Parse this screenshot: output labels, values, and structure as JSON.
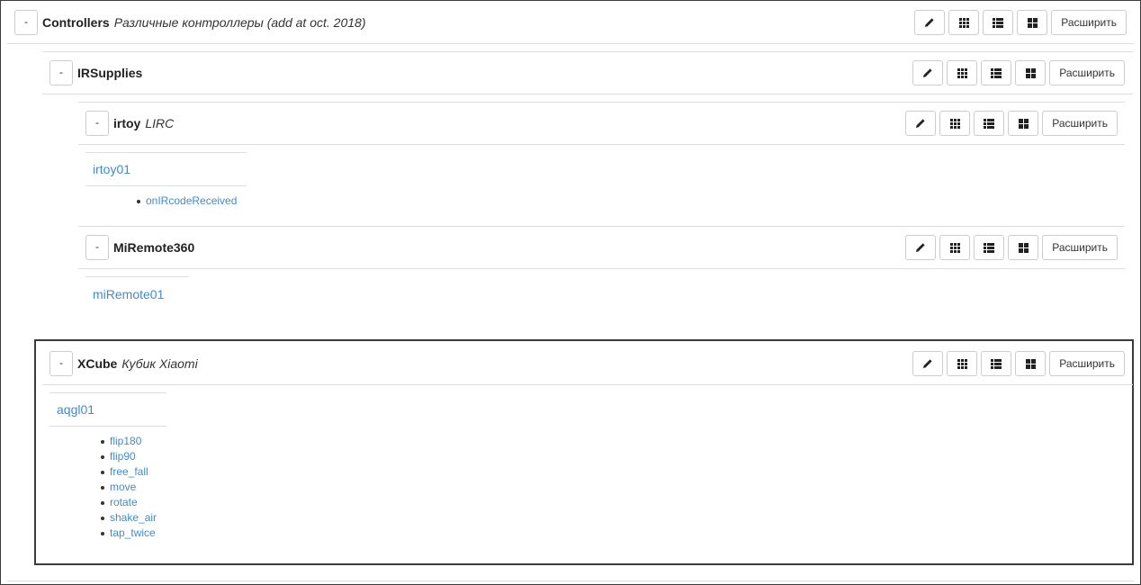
{
  "icons": {
    "edit": "pencil-icon",
    "grid_small": "grid-3x3-icon",
    "list": "list-icon",
    "grid_large": "grid-2x2-icon"
  },
  "collapse_label": "-",
  "expand_label": "Расширить",
  "sections": {
    "controllers": {
      "title": "Controllers",
      "subtitle": "Различные контроллеры (add at oct. 2018)"
    },
    "irsupplies": {
      "title": "IRSupplies"
    },
    "irtoy": {
      "title": "irtoy",
      "subtitle": "LIRC",
      "object": "irtoy01",
      "events": [
        "onIRcodeReceived"
      ]
    },
    "miremote": {
      "title": "MiRemote360",
      "object": "miRemote01"
    },
    "xcube": {
      "title": "XCube",
      "subtitle": "Кубик Xiaomi",
      "object": "aqgl01",
      "events": [
        "flip180",
        "flip90",
        "free_fall",
        "move",
        "rotate",
        "shake_air",
        "tap_twice"
      ]
    }
  },
  "colors": {
    "link": "#428bca",
    "border": "#dddddd",
    "highlight_border": "#3b3b3b"
  }
}
